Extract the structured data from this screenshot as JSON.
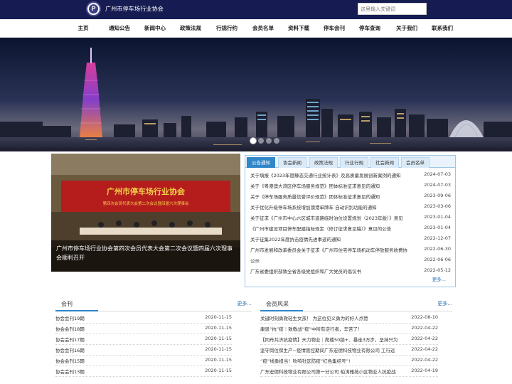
{
  "header": {
    "logo_letter": "P",
    "site_title": "广州市停车场行业协会",
    "search_placeholder": "这里输入关键词"
  },
  "nav": [
    {
      "label": "主页"
    },
    {
      "label": "通知公告"
    },
    {
      "label": "新闻中心"
    },
    {
      "label": "政策法规"
    },
    {
      "label": "行规行约"
    },
    {
      "label": "会员名单"
    },
    {
      "label": "资料下载"
    },
    {
      "label": "停车会刊"
    },
    {
      "label": "停车查询"
    },
    {
      "label": "关于我们"
    },
    {
      "label": "联系我们"
    }
  ],
  "hero": {
    "slide_count": 4,
    "active_slide": 1
  },
  "feature": {
    "banner_line1": "广州市停车场行业协会",
    "banner_line2": "第四次会员代表大会第二次会议暨四届六次理事会",
    "caption": "广州市停车场行业协会第四次会员代表大会第二次会议暨四届六次理事会顺利召开"
  },
  "notice": {
    "tabs": [
      "公告通知",
      "协会新闻",
      "政策法规",
      "行业行规",
      "社会新闻",
      "会员名单"
    ],
    "active_tab": 0,
    "items": [
      {
        "title": "关于填报《2023年度静态交通行业统计表》及高质量发展创新案例的通知",
        "date": "2024-07-03"
      },
      {
        "title": "关于《粤港澳大湾区停车场服务规范》团体标准征求意见的通知",
        "date": "2024-07-03"
      },
      {
        "title": "关于《停车场服务质量信誉评价规范》团体标准征求意见的通知",
        "date": "2023-09-06"
      },
      {
        "title": "关于优化升级停车场系统增加澳港单牌车 自动识别功能的通知",
        "date": "2023-03-06"
      },
      {
        "title": "关于征求《广州市中心六区城市道路临时泊位设置规划（2023年版）》意见",
        "date": "2023-01-04"
      },
      {
        "title": "《广州市建设项目停车配建指标规定（修订征求意见稿）》意见的公告",
        "date": "2023-01-04"
      },
      {
        "title": "关于征集2022年度抗击疫情先进事迹的通知",
        "date": "2022-12-07"
      },
      {
        "title": "广州市发展和改革委员会关于征求《广州市住宅停车场机动车停放服务收费协",
        "date": "2022-06-30"
      },
      {
        "title": "公示",
        "date": "2022-06-06"
      },
      {
        "title": "广东省委组织部致全省各级党组织和广大党员的倡议书",
        "date": "2022-05-12"
      }
    ],
    "more_label": "更多..."
  },
  "journal": {
    "title": "会刊",
    "more_label": "更多...",
    "items": [
      {
        "title": "协会会刊19期",
        "date": "2020-11-15"
      },
      {
        "title": "协会会刊18期",
        "date": "2020-11-15"
      },
      {
        "title": "协会会刊17期",
        "date": "2020-11-15"
      },
      {
        "title": "协会会刊16期",
        "date": "2020-11-15"
      },
      {
        "title": "协会会刊15期",
        "date": "2020-11-15"
      },
      {
        "title": "协会会刊13期",
        "date": "2020-11-15"
      }
    ]
  },
  "members": {
    "title": "会员风采",
    "more_label": "更多...",
    "items": [
      {
        "title": "关键时刻勇救轻生女孩！ 为这位见义勇为的好人点赞",
        "date": "2022-08-10"
      },
      {
        "title": "康恩“抗”疫｜致敬战“疫”中所有逆行者，辛苦了！",
        "date": "2022-04-22"
      },
      {
        "title": "【同舟共济抗疫情】天力物业｜爬楼50趟+、暴走3万步，坚持只为",
        "date": "2022-04-22"
      },
      {
        "title": "坚守岗位保生产~疫情管控期间广东宏德科技物业有限公司 工行远",
        "date": "2022-04-22"
      },
      {
        "title": "“疫”线勇担当！吹响社区防疫“红色集结号”!",
        "date": "2022-04-22"
      },
      {
        "title": "广东宏德科技物业有限公司第一分公司 柏涛雅苑小区物业人抗疫战",
        "date": "2022-04-19"
      }
    ]
  },
  "colors": {
    "topbar": "#161c52",
    "accent": "#2f86c9",
    "link": "#2f6fb0"
  }
}
